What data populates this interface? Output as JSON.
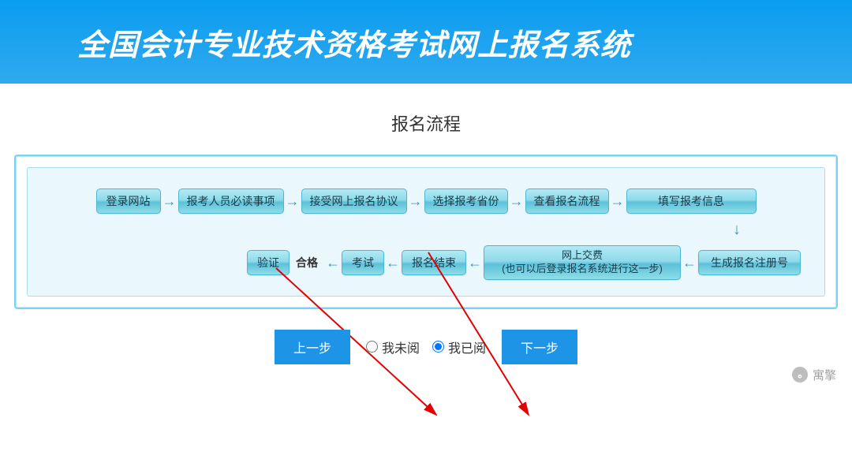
{
  "header": {
    "title": "全国会计专业技术资格考试网上报名系统"
  },
  "subtitle": "报名流程",
  "flow": {
    "row1": [
      "登录网站",
      "报考人员必读事项",
      "接受网上报名协议",
      "选择报考省份",
      "查看报名流程",
      "填写报考信息"
    ],
    "row2": {
      "verify": "验证",
      "pass_label": "合格",
      "exam": "考试",
      "end": "报名结束",
      "pay_line1": "网上交费",
      "pay_line2": "(也可以后登录报名系统进行这一步)",
      "regnum": "生成报名注册号"
    }
  },
  "actions": {
    "prev": "上一步",
    "next": "下一步",
    "radio_unread": "我未阅",
    "radio_read": "我已阅"
  },
  "watermark": {
    "icon": "ه",
    "text": "寓擎"
  }
}
